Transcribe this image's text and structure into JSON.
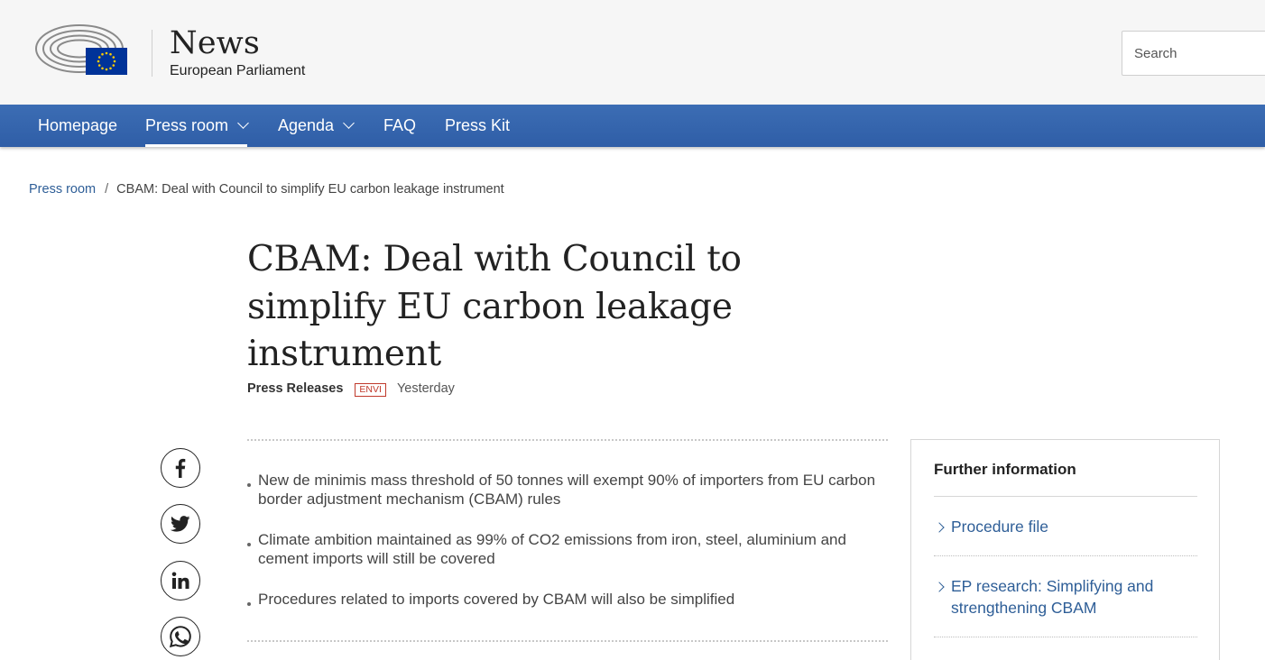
{
  "header": {
    "title": "News",
    "subtitle": "European Parliament",
    "logo_icon": "european-parliament-logo",
    "search": {
      "placeholder": "Search",
      "value": ""
    }
  },
  "nav": {
    "items": [
      {
        "label": "Homepage",
        "has_dropdown": false,
        "active": false
      },
      {
        "label": "Press room",
        "has_dropdown": true,
        "active": true
      },
      {
        "label": "Agenda",
        "has_dropdown": true,
        "active": false
      },
      {
        "label": "FAQ",
        "has_dropdown": false,
        "active": false
      },
      {
        "label": "Press Kit",
        "has_dropdown": false,
        "active": false
      }
    ]
  },
  "breadcrumb": {
    "items": [
      {
        "label": "Press room"
      },
      {
        "label": "CBAM: Deal with Council to simplify EU carbon leakage instrument"
      }
    ]
  },
  "article": {
    "title": "CBAM: Deal with Council to simplify EU carbon leakage instrument",
    "category": "Press Releases",
    "tag": "ENVI",
    "date": "Yesterday",
    "highlights": [
      "New de minimis mass threshold of 50 tonnes will exempt 90% of importers from EU carbon border adjustment mechanism (CBAM) rules",
      "Climate ambition maintained as 99% of CO2 emissions from iron, steel, aluminium and cement imports will still be covered",
      "Procedures related to imports covered by CBAM will also be simplified"
    ]
  },
  "share": {
    "icons": [
      "facebook-icon",
      "twitter-icon",
      "linkedin-icon",
      "whatsapp-icon"
    ]
  },
  "sidebar": {
    "title": "Further information",
    "links": [
      {
        "label": "Procedure file"
      },
      {
        "label": "EP research: Simplifying and strengthening CBAM"
      }
    ]
  },
  "colors": {
    "nav_background": "#2f5ea7",
    "link": "#2e5e97",
    "tag": "#c0392b",
    "header_background": "#f6f6f6",
    "eu_blue": "#003399",
    "eu_star": "#ffcc00"
  }
}
